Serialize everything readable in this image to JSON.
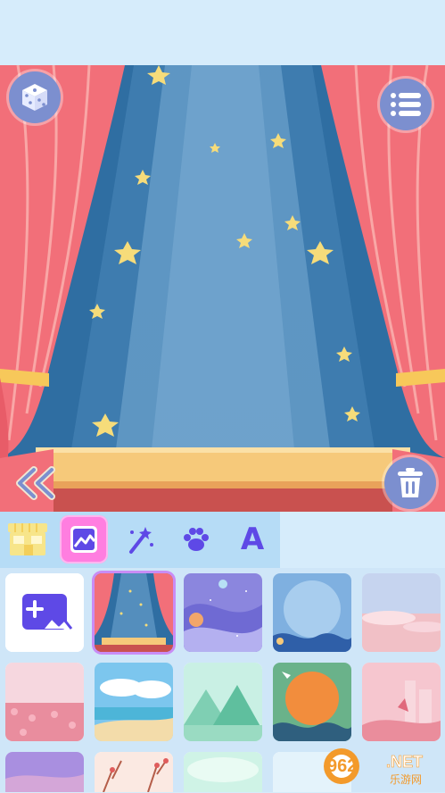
{
  "toolbar": {
    "tools": [
      {
        "icon": "shop-icon",
        "active": false
      },
      {
        "icon": "background-image-icon",
        "active": true
      },
      {
        "icon": "magic-wand-icon",
        "active": false
      },
      {
        "icon": "paw-icon",
        "active": false
      },
      {
        "icon": "text-a-icon",
        "active": false
      },
      {
        "text": "A"
      }
    ]
  },
  "watermark": {
    "number": "962",
    "suffix": ".NET",
    "subtitle": "乐游网"
  },
  "colors": {
    "curtain": "#f26f79",
    "stage_blue": "#2f6ea2",
    "spotlight": "#6ea4cf",
    "accent_pink": "#ff7ee0",
    "button": "#7c8fcf"
  }
}
